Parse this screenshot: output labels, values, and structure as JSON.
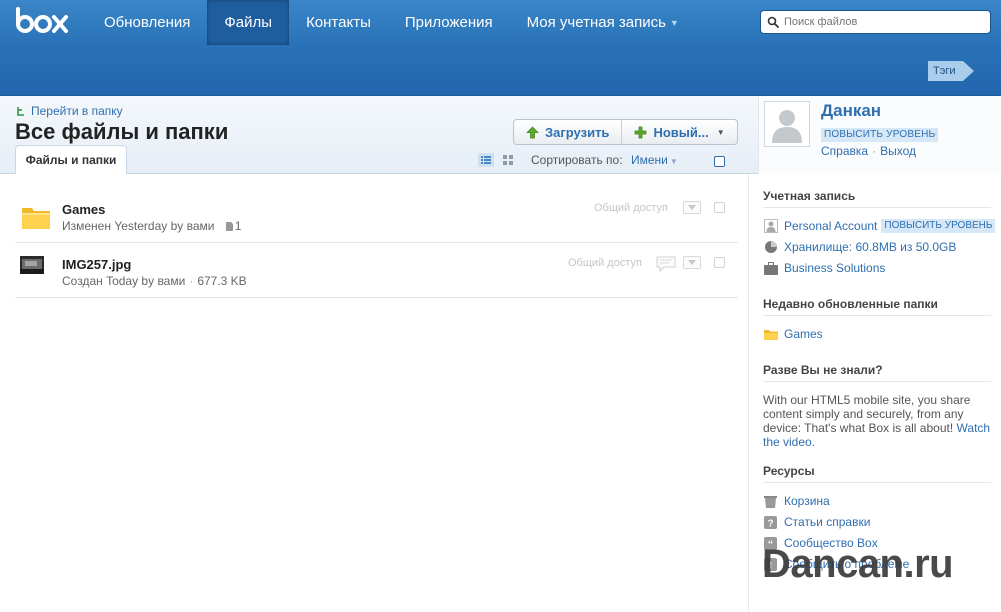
{
  "brand": {
    "logo_text": "box",
    "color": "#2a73b8"
  },
  "nav": [
    {
      "label": "Обновления",
      "active": false
    },
    {
      "label": "Файлы",
      "active": true
    },
    {
      "label": "Контакты",
      "active": false
    },
    {
      "label": "Приложения",
      "active": false
    },
    {
      "label": "Моя учетная запись",
      "active": false,
      "dropdown": true
    }
  ],
  "search": {
    "placeholder": "Поиск файлов",
    "icon": "search-icon"
  },
  "tags_tab": {
    "label": "Тэги"
  },
  "breadcrumb": {
    "goto_label": "Перейти в папку"
  },
  "page_title": "Все файлы и папки",
  "tab": {
    "label": "Файлы и папки"
  },
  "toolbar": {
    "upload_label": "Загрузить",
    "new_label": "Новый...",
    "sort_label": "Сортировать по:",
    "sort_value": "Имени"
  },
  "user": {
    "name": "Данкан",
    "upgrade_label": "ПОВЫСИТЬ УРОВЕНЬ",
    "help_label": "Справка",
    "logout_label": "Выход"
  },
  "files": [
    {
      "name": "Games",
      "type": "folder",
      "meta": "Изменен Yesterday by вами",
      "count": "1",
      "share_label": "Общий доступ"
    },
    {
      "name": "IMG257.jpg",
      "type": "image",
      "meta": "Создан Today by вами",
      "size": "677.3 KB",
      "share_label": "Общий доступ"
    }
  ],
  "sidebar": {
    "account_heading": "Учетная запись",
    "account_type": "Personal Account",
    "account_upgrade": "ПОВЫСИТЬ УРОВЕНЬ",
    "storage": "Хранилище: 60.8MB из 50.0GB",
    "business": "Business Solutions",
    "recent_heading": "Недавно обновленные папки",
    "recent_folder": "Games",
    "didyouknow_heading": "Разве Вы не знали?",
    "didyouknow_text": "With our HTML5 mobile site, you share content simply and securely, from any device: That's what Box is all about!",
    "didyouknow_link": "Watch the video.",
    "resources_heading": "Ресурсы",
    "resources": [
      "Корзина",
      "Статьи справки",
      "Сообщество Box",
      "Сообщить о проблеме"
    ]
  },
  "watermark": "Dancan.ru"
}
